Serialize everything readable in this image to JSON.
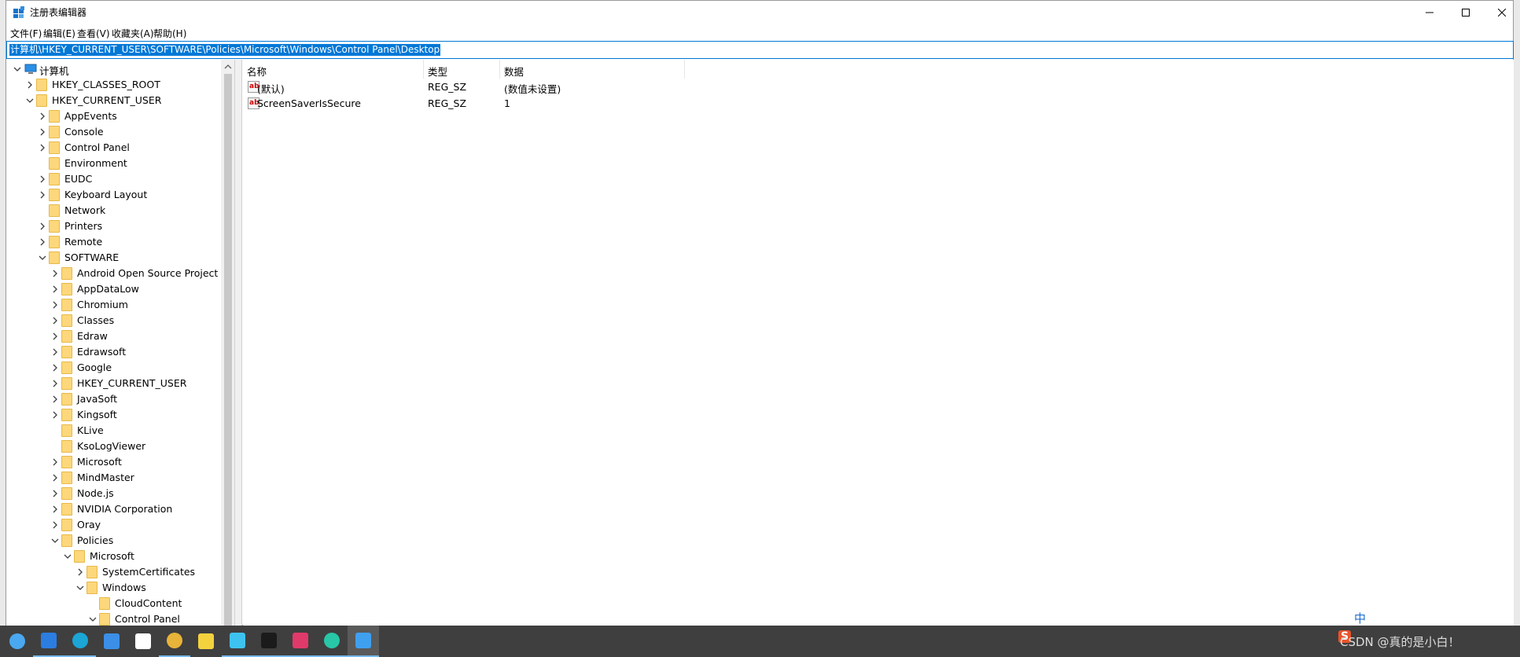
{
  "window": {
    "title": "注册表编辑器"
  },
  "menu": [
    "文件(F)",
    "编辑(E)",
    "查看(V)",
    "收藏夹(A)",
    "帮助(H)"
  ],
  "address": "计算机\\HKEY_CURRENT_USER\\SOFTWARE\\Policies\\Microsoft\\Windows\\Control Panel\\Desktop",
  "tree": [
    {
      "label": "计算机",
      "depth": 0,
      "state": "expanded",
      "icon": "computer-icon"
    },
    {
      "label": "HKEY_CLASSES_ROOT",
      "depth": 1,
      "state": "collapsed"
    },
    {
      "label": "HKEY_CURRENT_USER",
      "depth": 1,
      "state": "expanded"
    },
    {
      "label": "AppEvents",
      "depth": 2,
      "state": "collapsed"
    },
    {
      "label": "Console",
      "depth": 2,
      "state": "collapsed"
    },
    {
      "label": "Control Panel",
      "depth": 2,
      "state": "collapsed"
    },
    {
      "label": "Environment",
      "depth": 2,
      "state": "leaf"
    },
    {
      "label": "EUDC",
      "depth": 2,
      "state": "collapsed"
    },
    {
      "label": "Keyboard Layout",
      "depth": 2,
      "state": "collapsed"
    },
    {
      "label": "Network",
      "depth": 2,
      "state": "leaf"
    },
    {
      "label": "Printers",
      "depth": 2,
      "state": "collapsed"
    },
    {
      "label": "Remote",
      "depth": 2,
      "state": "collapsed"
    },
    {
      "label": "SOFTWARE",
      "depth": 2,
      "state": "expanded"
    },
    {
      "label": "Android Open Source Project",
      "depth": 3,
      "state": "collapsed"
    },
    {
      "label": "AppDataLow",
      "depth": 3,
      "state": "collapsed"
    },
    {
      "label": "Chromium",
      "depth": 3,
      "state": "collapsed"
    },
    {
      "label": "Classes",
      "depth": 3,
      "state": "collapsed"
    },
    {
      "label": "Edraw",
      "depth": 3,
      "state": "collapsed"
    },
    {
      "label": "Edrawsoft",
      "depth": 3,
      "state": "collapsed"
    },
    {
      "label": "Google",
      "depth": 3,
      "state": "collapsed"
    },
    {
      "label": "HKEY_CURRENT_USER",
      "depth": 3,
      "state": "collapsed"
    },
    {
      "label": "JavaSoft",
      "depth": 3,
      "state": "collapsed"
    },
    {
      "label": "Kingsoft",
      "depth": 3,
      "state": "collapsed"
    },
    {
      "label": "KLive",
      "depth": 3,
      "state": "leaf"
    },
    {
      "label": "KsoLogViewer",
      "depth": 3,
      "state": "leaf"
    },
    {
      "label": "Microsoft",
      "depth": 3,
      "state": "collapsed"
    },
    {
      "label": "MindMaster",
      "depth": 3,
      "state": "collapsed"
    },
    {
      "label": "Node.js",
      "depth": 3,
      "state": "collapsed"
    },
    {
      "label": "NVIDIA Corporation",
      "depth": 3,
      "state": "collapsed"
    },
    {
      "label": "Oray",
      "depth": 3,
      "state": "collapsed"
    },
    {
      "label": "Policies",
      "depth": 3,
      "state": "expanded"
    },
    {
      "label": "Microsoft",
      "depth": 4,
      "state": "expanded"
    },
    {
      "label": "SystemCertificates",
      "depth": 5,
      "state": "collapsed"
    },
    {
      "label": "Windows",
      "depth": 5,
      "state": "expanded"
    },
    {
      "label": "CloudContent",
      "depth": 6,
      "state": "leaf"
    },
    {
      "label": "Control Panel",
      "depth": 6,
      "state": "expanded"
    }
  ],
  "columns": [
    "名称",
    "类型",
    "数据"
  ],
  "values": [
    {
      "name": "(默认)",
      "type": "REG_SZ",
      "data": "(数值未设置)"
    },
    {
      "name": "ScreenSaverIsSecure",
      "type": "REG_SZ",
      "data": "1"
    }
  ],
  "taskbar": {
    "apps": [
      "qq-icon",
      "vscode-icon",
      "edge-icon",
      "mail-icon",
      "typora-icon",
      "chrome-icon",
      "sticky-notes-icon",
      "search-tool-icon",
      "terminal-icon",
      "intellij-icon",
      "pycharm-icon",
      "regedit-icon"
    ],
    "tray_text": "CSDN @真的是小白！",
    "ime": "中"
  },
  "colors": {
    "accent": "#0078d7",
    "folder": "#fdd77b",
    "taskbar": "#3f3f3f"
  }
}
